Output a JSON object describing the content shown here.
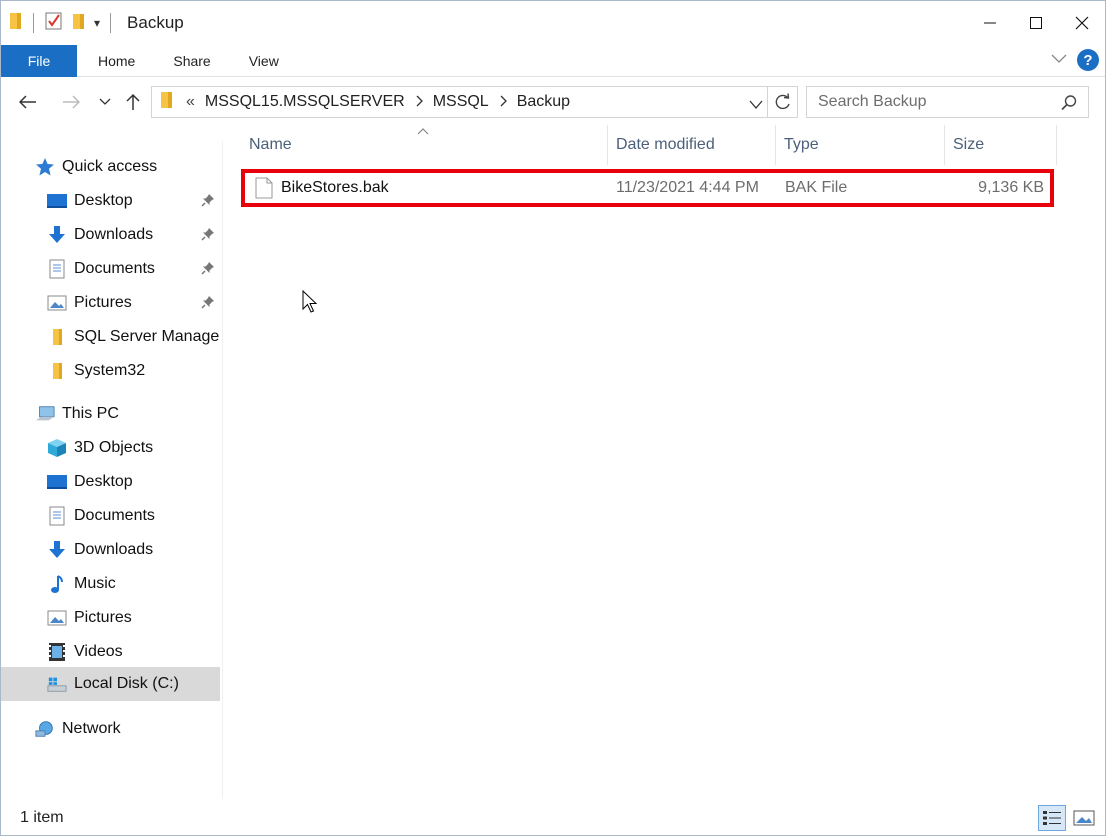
{
  "window": {
    "title": "Backup"
  },
  "ribbon": {
    "tabs": [
      "File",
      "Home",
      "Share",
      "View"
    ]
  },
  "address": {
    "segments": [
      "MSSQL15.MSSQLSERVER",
      "MSSQL",
      "Backup"
    ],
    "overflow": "«"
  },
  "search": {
    "placeholder": "Search Backup"
  },
  "sidebar": {
    "quick_access": "Quick access",
    "quick_items": [
      "Desktop",
      "Downloads",
      "Documents",
      "Pictures",
      "SQL Server Manage",
      "System32"
    ],
    "this_pc": "This PC",
    "pc_items": [
      "3D Objects",
      "Desktop",
      "Documents",
      "Downloads",
      "Music",
      "Pictures",
      "Videos",
      "Local Disk (C:)"
    ],
    "network": "Network"
  },
  "columns": {
    "name": "Name",
    "date": "Date modified",
    "type": "Type",
    "size": "Size"
  },
  "files": [
    {
      "name": "BikeStores.bak",
      "date": "11/23/2021 4:44 PM",
      "type": "BAK File",
      "size": "9,136 KB",
      "highlighted": true
    }
  ],
  "status": {
    "count": "1 item"
  },
  "colors": {
    "accent": "#1a6fc4",
    "highlight": "#e8000b",
    "folder": "#f6c344"
  }
}
